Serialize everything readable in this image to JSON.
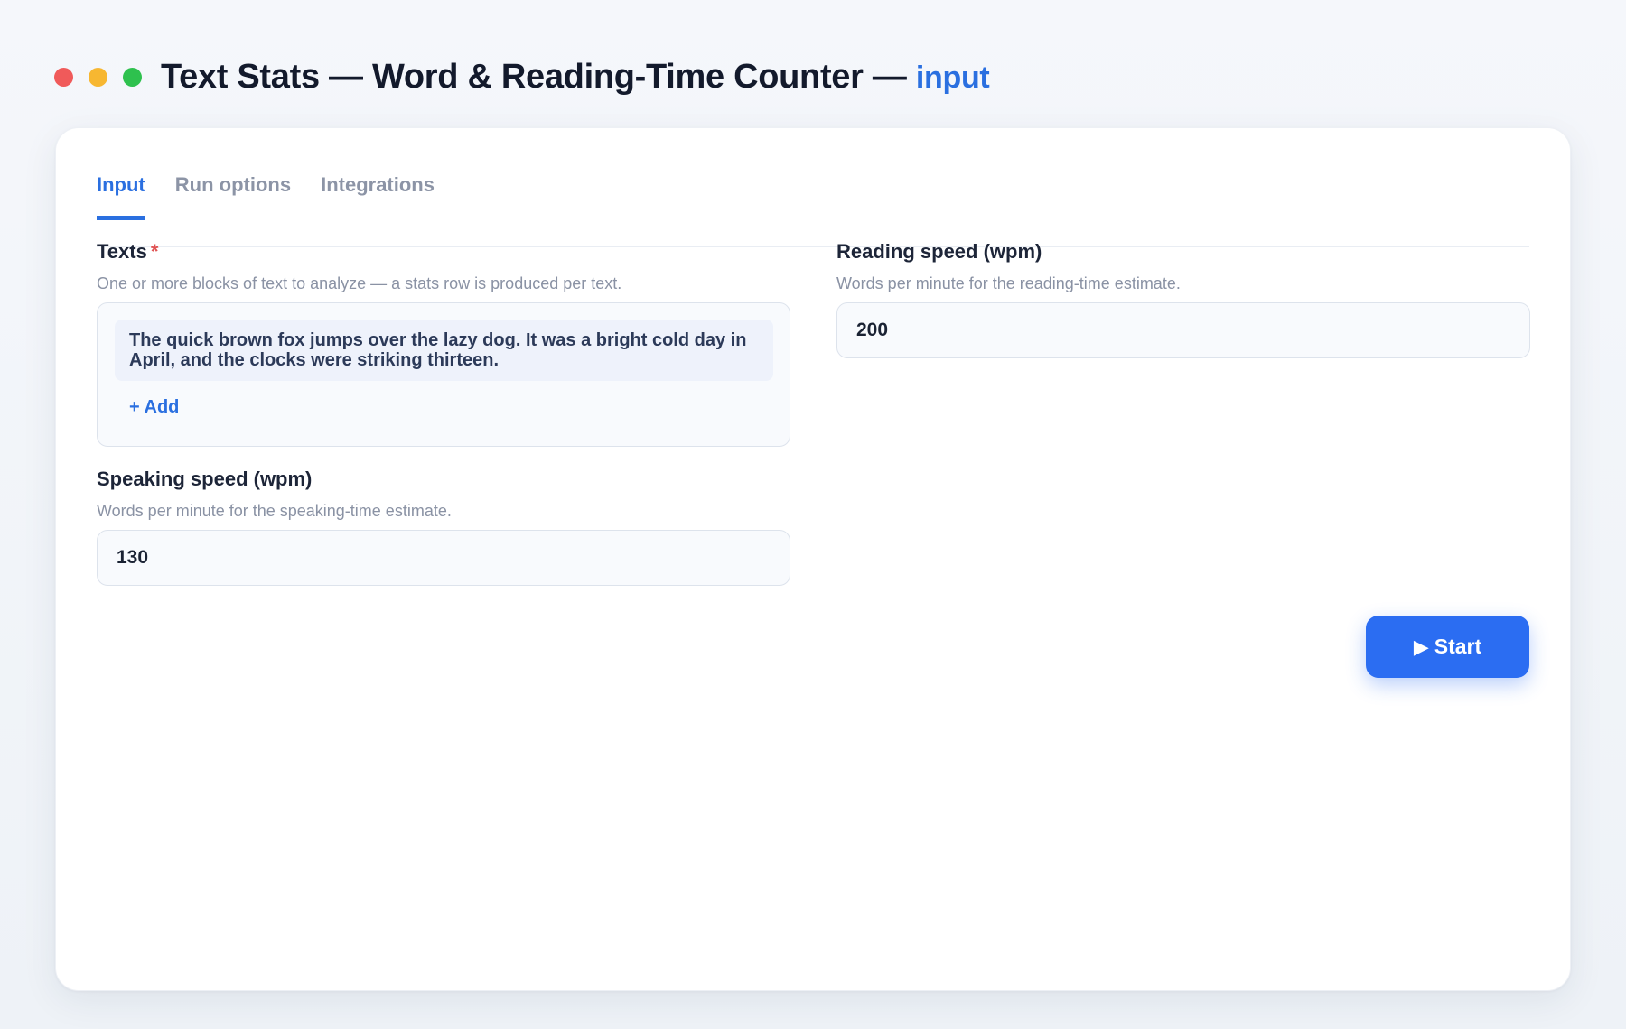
{
  "window": {
    "title": "Text Stats — Word & Reading-Time Counter —",
    "subtitle": "input"
  },
  "tabs": [
    {
      "label": "Input",
      "active": true
    },
    {
      "label": "Run options",
      "active": false
    },
    {
      "label": "Integrations",
      "active": false
    }
  ],
  "fields": {
    "texts": {
      "label": "Texts",
      "required_mark": "*",
      "help": "One or more blocks of text to analyze — a stats row is produced per text.",
      "items": [
        "The quick brown fox jumps over the lazy dog. It was a bright cold day in April, and the clocks were striking thirteen."
      ],
      "add_label": "+ Add"
    },
    "reading_speed": {
      "label": "Reading speed (wpm)",
      "help": "Words per minute for the reading-time estimate.",
      "value": "200"
    },
    "speaking_speed": {
      "label": "Speaking speed (wpm)",
      "help": "Words per minute for the speaking-time estimate.",
      "value": "130"
    }
  },
  "actions": {
    "start_icon": "▶",
    "start_label": "Start"
  },
  "colors": {
    "accent": "#2a6fe0",
    "button": "#2b6df2",
    "required": "#e05252",
    "window_red": "#f05a5a",
    "window_yellow": "#f7b731",
    "window_green": "#2ec14e"
  }
}
